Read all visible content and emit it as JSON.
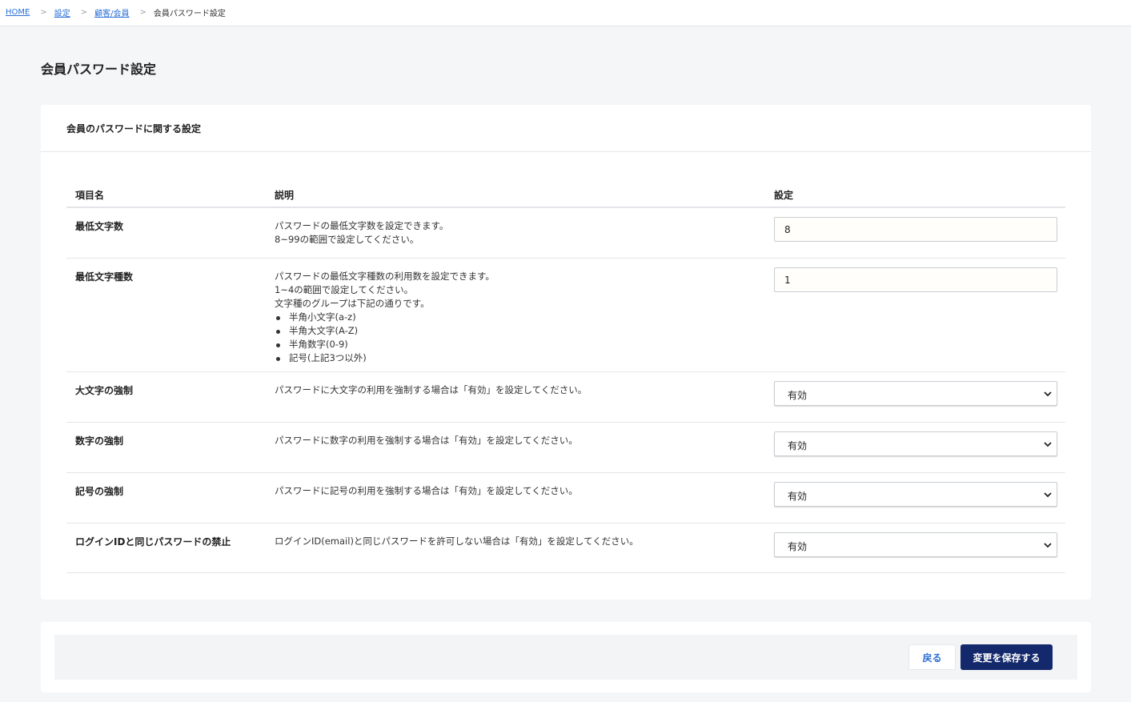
{
  "breadcrumb": {
    "items": [
      "HOME",
      "設定",
      "顧客/会員"
    ],
    "separator": ">",
    "current": "会員パスワード設定"
  },
  "page_title": "会員パスワード設定",
  "card": {
    "title": "会員のパスワードに関する設定",
    "headers": {
      "name": "項目名",
      "desc": "説明",
      "setting": "設定"
    },
    "rows": [
      {
        "name": "最低文字数",
        "desc": [
          "パスワードの最低文字数を設定できます。",
          "8~99の範囲で設定してください。"
        ],
        "value": "8"
      },
      {
        "name": "最低文字種数",
        "desc": [
          "パスワードの最低文字種数の利用数を設定できます。",
          "1~4の範囲で設定してください。",
          "文字種のグループは下記の通りです。"
        ],
        "bullets": [
          "半角小文字(a-z)",
          "半角大文字(A-Z)",
          "半角数字(0-9)",
          "記号(上記3つ以外)"
        ],
        "value": "1"
      },
      {
        "name": "大文字の強制",
        "desc": [
          "パスワードに大文字の利用を強制する場合は「有効」を設定してください。"
        ],
        "value": "有効"
      },
      {
        "name": "数字の強制",
        "desc": [
          "パスワードに数字の利用を強制する場合は「有効」を設定してください。"
        ],
        "value": "有効"
      },
      {
        "name": "記号の強制",
        "desc": [
          "パスワードに記号の利用を強制する場合は「有効」を設定してください。"
        ],
        "value": "有効"
      },
      {
        "name": "ログインIDと同じパスワードの禁止",
        "desc": [
          "ログインID(email)と同じパスワードを許可しない場合は「有効」を設定してください。"
        ],
        "value": "有効"
      }
    ]
  },
  "footer": {
    "back_label": "戻る",
    "save_label": "変更を保存する"
  },
  "colors": {
    "link": "#2a6fd6",
    "primary_button": "#14296b",
    "background": "#f5f6f8"
  }
}
